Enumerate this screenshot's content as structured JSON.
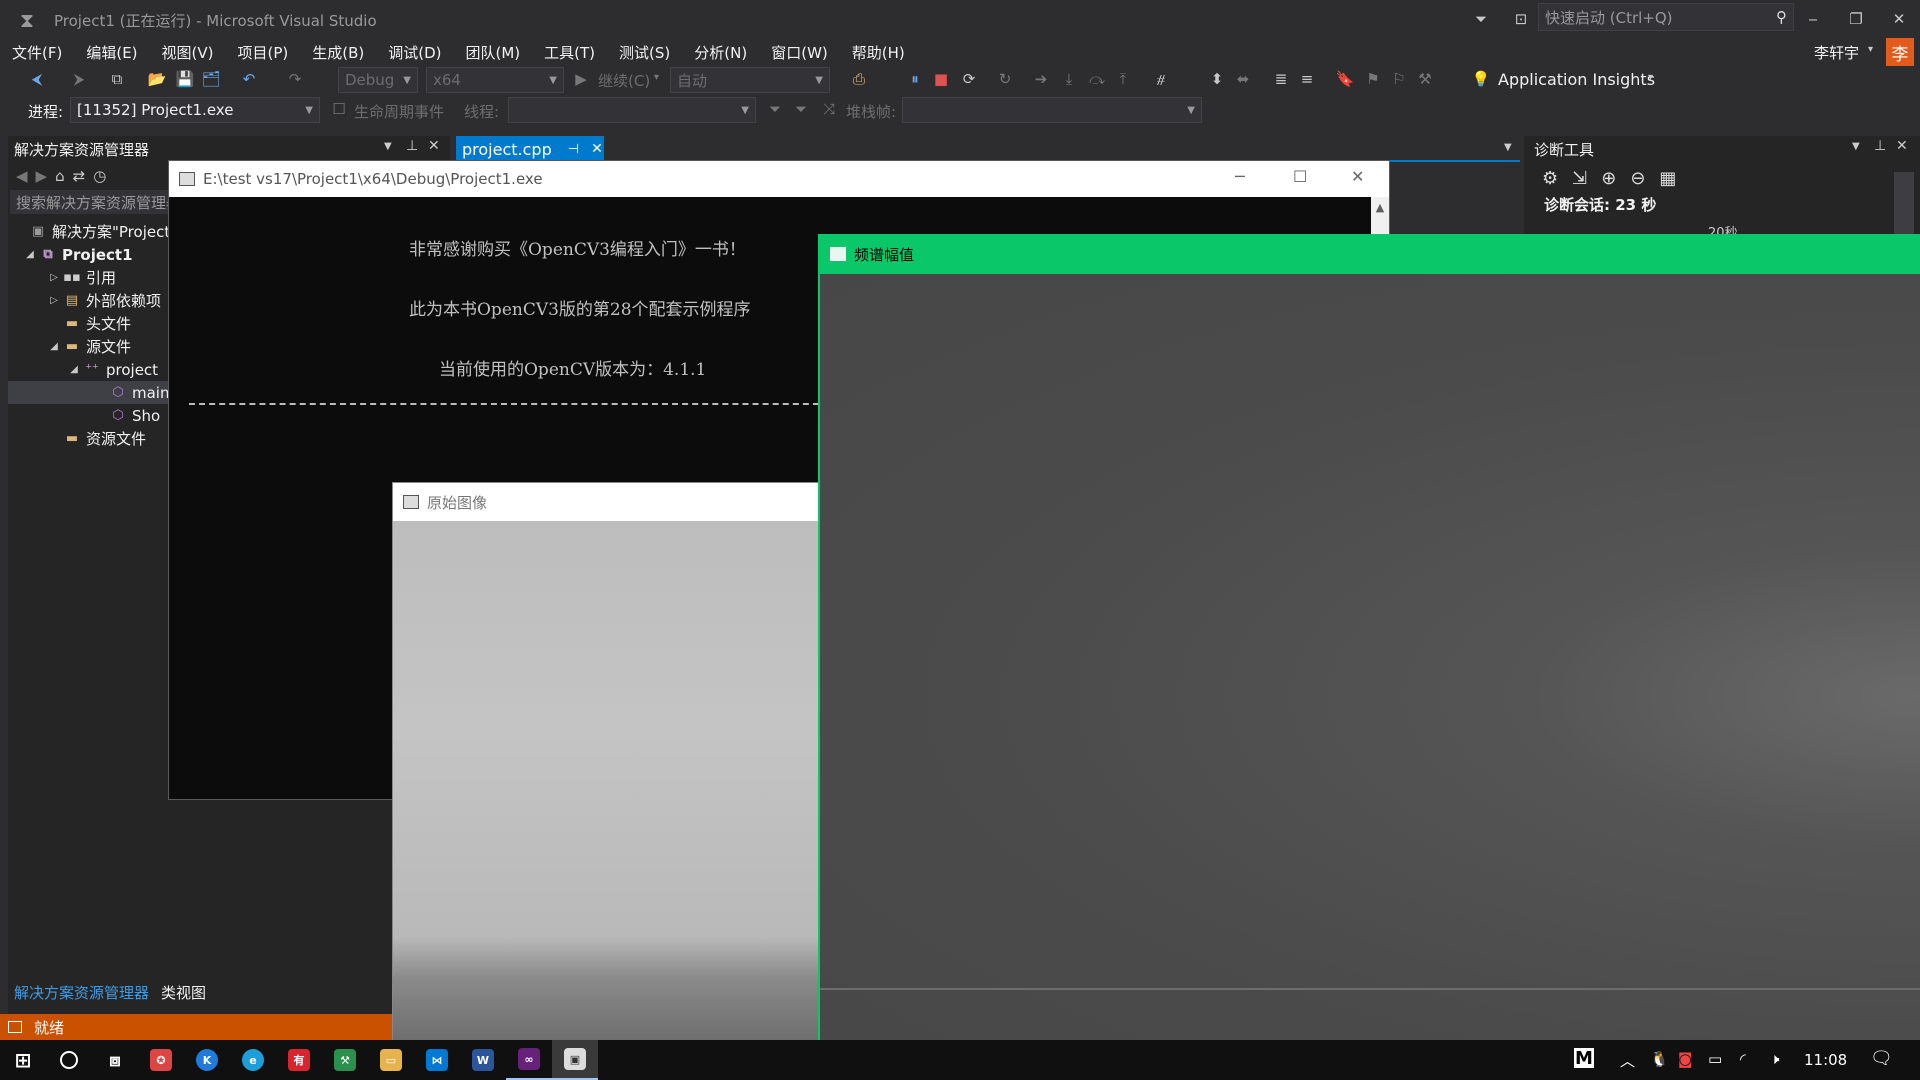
{
  "titlebar": {
    "title": "Project1 (正在运行) - Microsoft Visual Studio",
    "quick_launch_placeholder": "快速启动 (Ctrl+Q)"
  },
  "menu": [
    "文件(F)",
    "编辑(E)",
    "视图(V)",
    "项目(P)",
    "生成(B)",
    "调试(D)",
    "团队(M)",
    "工具(T)",
    "测试(S)",
    "分析(N)",
    "窗口(W)",
    "帮助(H)"
  ],
  "user": {
    "name": "李轩宇",
    "avatar": "李"
  },
  "toolbar": {
    "config": "Debug",
    "platform": "x64",
    "continue": "继续(C)",
    "auto": "自动",
    "app_insights": "Application Insights"
  },
  "debug_bar": {
    "process_label": "进程:",
    "process_value": "[11352] Project1.exe",
    "lifecycle": "生命周期事件",
    "thread_label": "线程:",
    "stack_label": "堆栈帧:"
  },
  "solution_explorer": {
    "title": "解决方案资源管理器",
    "search_placeholder": "搜索解决方案资源管理器",
    "items": [
      {
        "label": "解决方案\"Project",
        "indent": 0,
        "tri": "",
        "icon": "solution-icon"
      },
      {
        "label": "Project1",
        "indent": 1,
        "tri": "◢",
        "icon": "project-icon"
      },
      {
        "label": "引用",
        "indent": 2,
        "tri": "▷",
        "icon": "references-icon"
      },
      {
        "label": "外部依赖项",
        "indent": 2,
        "tri": "▷",
        "icon": "external-deps-icon"
      },
      {
        "label": "头文件",
        "indent": 2,
        "tri": "",
        "icon": "folder-icon"
      },
      {
        "label": "源文件",
        "indent": 2,
        "tri": "◢",
        "icon": "folder-icon"
      },
      {
        "label": "project",
        "indent": 3,
        "tri": "◢",
        "icon": "cpp-file-icon"
      },
      {
        "label": "main",
        "indent": 4,
        "tri": "",
        "icon": "cpp-symbol-icon"
      },
      {
        "label": "Sho",
        "indent": 4,
        "tri": "",
        "icon": "cpp-symbol-icon"
      },
      {
        "label": "资源文件",
        "indent": 2,
        "tri": "",
        "icon": "folder-icon"
      }
    ],
    "bottom_tabs": [
      "解决方案资源管理器",
      "类视图"
    ]
  },
  "editor_tab": {
    "label": "project.cpp"
  },
  "diagnostics": {
    "title": "诊断工具",
    "session": "诊断会话: 23 秒",
    "timeline_label": "20秒"
  },
  "console_window": {
    "title": "E:\\test  vs17\\Project1\\x64\\Debug\\Project1.exe",
    "lines": [
      "非常感谢购买《OpenCV3编程入门》一书！",
      "此为本书OpenCV3版的第28个配套示例程序",
      "当前使用的OpenCV版本为：4.1.1"
    ]
  },
  "original_image_window": {
    "title": "原始图像"
  },
  "spectrum_window": {
    "title": "频谱幅值"
  },
  "status_bar": {
    "text": "就绪"
  },
  "taskbar": {
    "clock": "11:08"
  }
}
